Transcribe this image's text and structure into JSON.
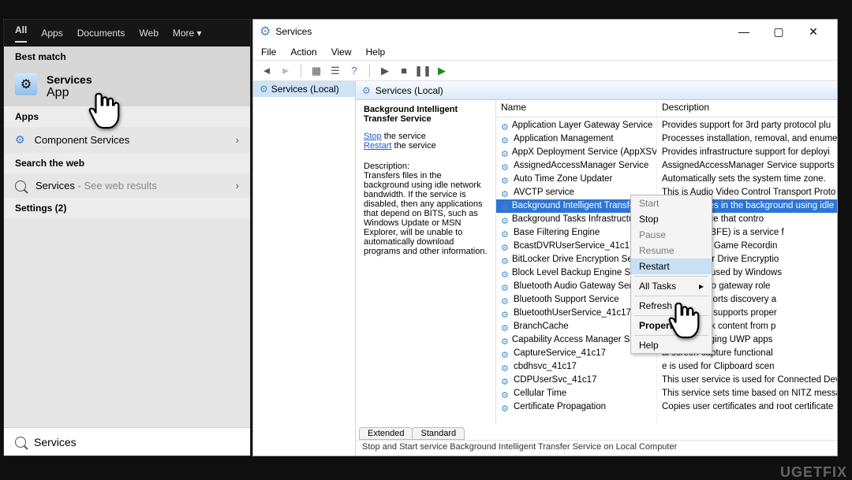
{
  "search": {
    "tabs": [
      "All",
      "Apps",
      "Documents",
      "Web",
      "More ▾"
    ],
    "best_match_header": "Best match",
    "best_match": {
      "title": "Services",
      "subtitle": "App"
    },
    "apps_header": "Apps",
    "apps_item": "Component Services",
    "web_header": "Search the web",
    "web_item_prefix": "Services",
    "web_item_suffix": " - See web results",
    "settings_header": "Settings (2)",
    "input_value": "Services"
  },
  "svc": {
    "title": "Services",
    "menus": [
      "File",
      "Action",
      "View",
      "Help"
    ],
    "tree_node": "Services (Local)",
    "bar_label": "Services (Local)",
    "detail": {
      "name": "Background Intelligent Transfer Service",
      "stop_word": "Stop",
      "restart_word": "Restart",
      "tail": " the service",
      "desc_label": "Description:",
      "desc": "Transfers files in the background using idle network bandwidth. If the service is disabled, then any applications that depend on BITS, such as Windows Update or MSN Explorer, will be unable to automatically download programs and other information."
    },
    "col_name": "Name",
    "col_desc": "Description",
    "names": [
      "Application Layer Gateway Service",
      "Application Management",
      "AppX Deployment Service (AppXSVC)",
      "AssignedAccessManager Service",
      "Auto Time Zone Updater",
      "AVCTP service",
      "Background Intelligent Transfer Service",
      "Background Tasks Infrastructure Service",
      "Base Filtering Engine",
      "BcastDVRUserService_41c17",
      "BitLocker Drive Encryption Service",
      "Block Level Backup Engine Service",
      "Bluetooth Audio Gateway Service",
      "Bluetooth Support Service",
      "BluetoothUserService_41c17",
      "BranchCache",
      "Capability Access Manager Service",
      "CaptureService_41c17",
      "cbdhsvc_41c17",
      "CDPUserSvc_41c17",
      "Cellular Time",
      "Certificate Propagation"
    ],
    "selected_index": 6,
    "descs": [
      "Provides support for 3rd party protocol plu",
      "Processes installation, removal, and enume",
      "Provides infrastructure support for deployi",
      "AssignedAccessManager Service supports",
      "Automatically sets the system time zone.",
      "This is Audio Video Control Transport Proto",
      "Transfers files in the background using idle",
      "ucture service that contro",
      "ing Engine (BFE) is a service f",
      "e is used for Game Recordin",
      "the BitLocker Drive Encryptio",
      "E service is used by Windows",
      "ting the audio gateway role",
      "service supports discovery a",
      "user service supports proper",
      "ches network content from p",
      "es for managing UWP apps",
      "al screen capture functional",
      "e is used for Clipboard scen",
      "This user service is used for Connected Dev",
      "This service sets time based on NITZ messa",
      "Copies user certificates and root certificate"
    ],
    "ctx": {
      "start": "Start",
      "stop": "Stop",
      "pause": "Pause",
      "resume": "Resume",
      "restart": "Restart",
      "all_tasks": "All Tasks",
      "refresh": "Refresh",
      "properties": "Properties",
      "help": "Help"
    },
    "tabs": [
      "Extended",
      "Standard"
    ],
    "status": "Stop and Start service Background Intelligent Transfer Service on Local Computer"
  },
  "watermark": "UGETFIX"
}
